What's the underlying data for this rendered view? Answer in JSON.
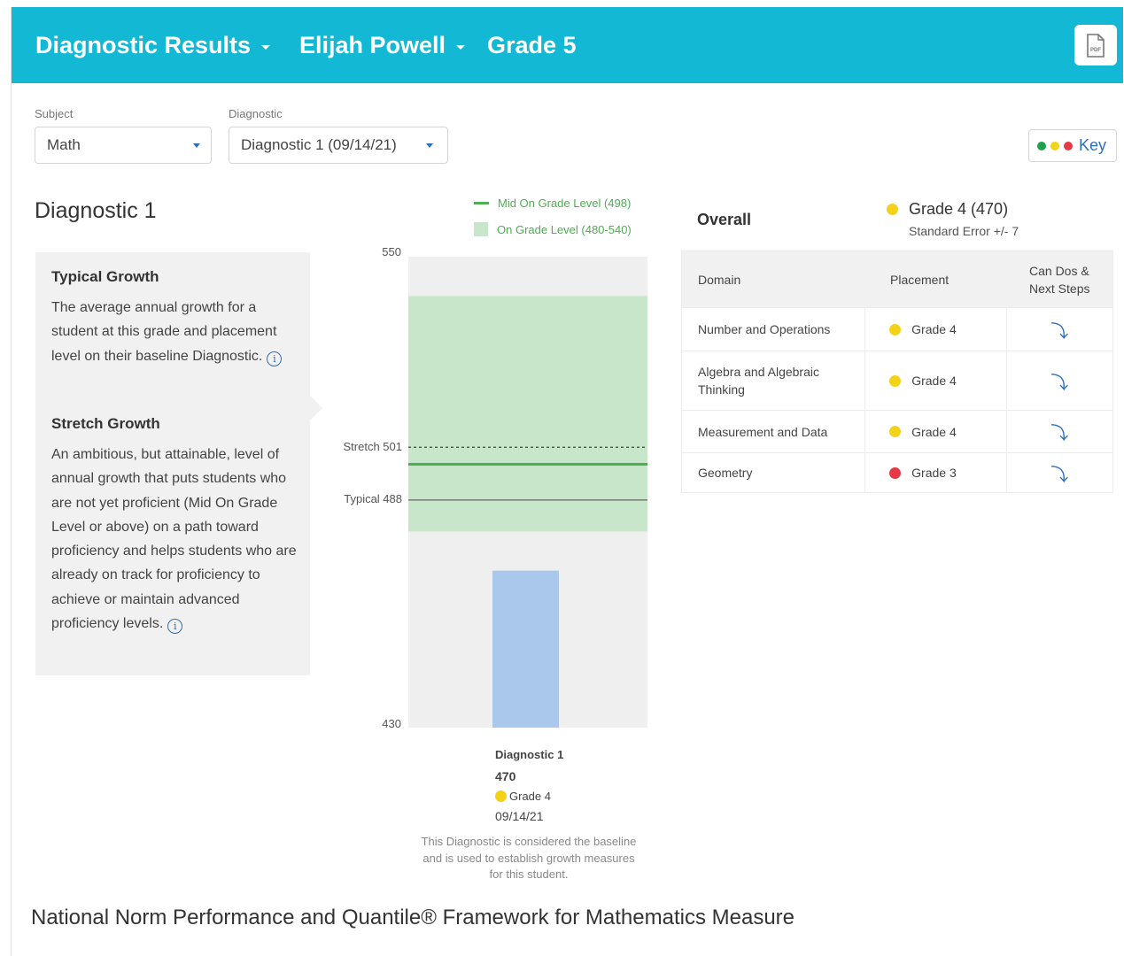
{
  "header": {
    "report_title": "Diagnostic Results",
    "student_name": "Elijah Powell",
    "grade": "Grade 5",
    "pdf_icon_text": "PDF"
  },
  "filters": {
    "subject": {
      "label": "Subject",
      "value": "Math"
    },
    "diagnostic": {
      "label": "Diagnostic",
      "value": "Diagnostic 1 (09/14/21)"
    }
  },
  "key_button": {
    "label": "Key"
  },
  "section_title": "Diagnostic 1",
  "info": {
    "typical_growth": {
      "heading": "Typical Growth",
      "body": "The average annual growth for a student at this grade and placement level on their baseline Diagnostic."
    },
    "stretch_growth": {
      "heading": "Stretch Growth",
      "body": "An ambitious, but attainable, level of annual growth that puts students who are not yet proficient (Mid On Grade Level or above) on a path toward proficiency and helps students who are already on track for proficiency to achieve or maintain advanced proficiency levels."
    }
  },
  "chart_data": {
    "type": "bar",
    "legend": [
      {
        "label": "Mid On Grade Level (498)",
        "kind": "line",
        "color": "#4caf50"
      },
      {
        "label": "On Grade Level (480-540)",
        "kind": "band",
        "color": "#c8e6c9"
      }
    ],
    "ylim": [
      430,
      550
    ],
    "y_ticks": [
      "550",
      "430"
    ],
    "on_grade_band": [
      480,
      540
    ],
    "mid_on_grade": 498,
    "stretch": {
      "label": "Stretch 501",
      "value": 501
    },
    "typical": {
      "label": "Typical 488",
      "value": 488
    },
    "bar": {
      "label": "Diagnostic 1",
      "value": 470,
      "score_text": "470",
      "placement": "Grade 4",
      "date": "09/14/21",
      "color": "#aac8ec"
    },
    "note": "This Diagnostic is considered the baseline and is used to establish growth measures for this student."
  },
  "overall": {
    "label": "Overall",
    "placement": "Grade 4 (470)",
    "standard_error": "Standard Error +/- 7"
  },
  "domains_table": {
    "headers": [
      "Domain",
      "Placement",
      "Can Dos & Next Steps"
    ],
    "rows": [
      {
        "domain": "Number and Operations",
        "placement": "Grade 4",
        "status": "yellow"
      },
      {
        "domain": "Algebra and Algebraic Thinking",
        "placement": "Grade 4",
        "status": "yellow"
      },
      {
        "domain": "Measurement and Data",
        "placement": "Grade 4",
        "status": "yellow"
      },
      {
        "domain": "Geometry",
        "placement": "Grade 3",
        "status": "red"
      }
    ]
  },
  "colors": {
    "header_bg": "#12b8d4",
    "link_blue": "#2a6fc0",
    "status_green": "#1fa04a",
    "status_yellow": "#f5d21a",
    "status_red": "#e53945"
  },
  "footer_title": "National Norm Performance and Quantile® Framework for Mathematics Measure"
}
